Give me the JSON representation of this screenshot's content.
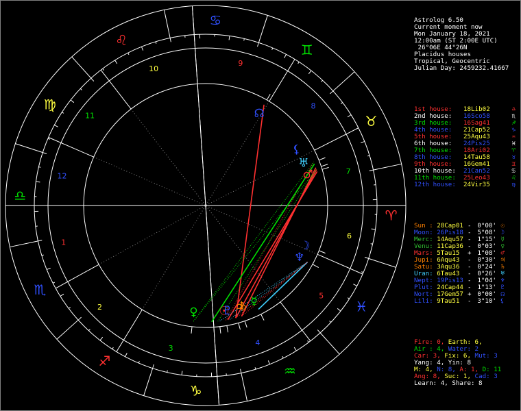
{
  "header": [
    "Astrolog 6.50",
    "Current moment now",
    "Mon January 18, 2021",
    "12:00am (ST 2:00E UTC)",
    " 26°06E 44°26N",
    "Placidus houses",
    "Tropical, Geocentric",
    "Julian Day: 2459232.41667"
  ],
  "colors": {
    "white": "#ffffff",
    "gray": "#c0c0c0",
    "red": "#ff3030",
    "green": "#00e000",
    "yellow": "#ffff40",
    "blue": "#3050ff",
    "cyan": "#40d0ff",
    "magenta": "#ff40ff",
    "orange": "#ff8000",
    "dkgreen": "#30c030"
  },
  "houses": [
    {
      "label": "1st house:",
      "value": "18Lib02",
      "glyph": "♎",
      "color": "red",
      "vcolor": "yellow"
    },
    {
      "label": "2nd house:",
      "value": "16Sco58",
      "glyph": "♏",
      "color": "white",
      "vcolor": "blue"
    },
    {
      "label": "3rd house:",
      "value": "16Sag41",
      "glyph": "♐",
      "color": "green",
      "vcolor": "red"
    },
    {
      "label": "4th house:",
      "value": "21Cap52",
      "glyph": "♑",
      "color": "blue",
      "vcolor": "yellow"
    },
    {
      "label": "5th house:",
      "value": "25Aqu43",
      "glyph": "♒",
      "color": "red",
      "vcolor": "yellow"
    },
    {
      "label": "6th house:",
      "value": "24Pis25",
      "glyph": "♓",
      "color": "white",
      "vcolor": "blue"
    },
    {
      "label": "7th house:",
      "value": "18Ari02",
      "glyph": "♈",
      "color": "green",
      "vcolor": "red"
    },
    {
      "label": "8th house:",
      "value": "14Tau58",
      "glyph": "♉",
      "color": "blue",
      "vcolor": "yellow"
    },
    {
      "label": "9th house:",
      "value": "16Gem41",
      "glyph": "♊",
      "color": "red",
      "vcolor": "yellow"
    },
    {
      "label": "10th house:",
      "value": "21Can52",
      "glyph": "♋",
      "color": "white",
      "vcolor": "blue"
    },
    {
      "label": "11th house:",
      "value": "25Leo43",
      "glyph": "♌",
      "color": "green",
      "vcolor": "red"
    },
    {
      "label": "12th house:",
      "value": "24Vir35",
      "glyph": "♍",
      "color": "blue",
      "vcolor": "yellow"
    }
  ],
  "planets": [
    {
      "name": "Sun :",
      "pos": "28Cap01",
      "sign": "-",
      "speed": "0°00'",
      "glyph": "☉",
      "color": "orange",
      "vcolor": "yellow"
    },
    {
      "name": "Moon:",
      "pos": "26Pis18",
      "sign": "-",
      "speed": "5°08'",
      "glyph": "☽",
      "color": "blue",
      "vcolor": "blue"
    },
    {
      "name": "Merc:",
      "pos": "14Aqu57",
      "sign": "-",
      "speed": "1°15'",
      "glyph": "☿",
      "color": "dkgreen",
      "vcolor": "yellow"
    },
    {
      "name": "Venu:",
      "pos": "11Cap36",
      "sign": "-",
      "speed": "0°03'",
      "glyph": "♀",
      "color": "dkgreen",
      "vcolor": "yellow"
    },
    {
      "name": "Mars:",
      "pos": "5Tau15",
      "sign": "+",
      "speed": "1°08'",
      "glyph": "♂",
      "color": "red",
      "vcolor": "yellow"
    },
    {
      "name": "Jupi:",
      "pos": "6Aqu43",
      "sign": "-",
      "speed": "0°30'",
      "glyph": "♃",
      "color": "orange",
      "vcolor": "yellow"
    },
    {
      "name": "Satu:",
      "pos": "3Aqu36",
      "sign": "-",
      "speed": "0°24'",
      "glyph": "♄",
      "color": "orange",
      "vcolor": "yellow"
    },
    {
      "name": "Uran:",
      "pos": "6Tau43",
      "sign": "-",
      "speed": "0°26'",
      "glyph": "♅",
      "color": "cyan",
      "vcolor": "yellow"
    },
    {
      "name": "Nept:",
      "pos": "19Pis13",
      "sign": "-",
      "speed": "1°04'",
      "glyph": "♆",
      "color": "blue",
      "vcolor": "blue"
    },
    {
      "name": "Plut:",
      "pos": "24Cap44",
      "sign": "-",
      "speed": "1°13'",
      "glyph": "♇",
      "color": "blue",
      "vcolor": "yellow"
    },
    {
      "name": "Nort:",
      "pos": "17Gem57R",
      "sign": "+",
      "speed": "0°00'",
      "glyph": "☊",
      "color": "blue",
      "vcolor": "yellow"
    },
    {
      "name": "Lili:",
      "pos": "9Tau51",
      "sign": "-",
      "speed": "3°10'",
      "glyph": "⚸",
      "color": "blue",
      "vcolor": "yellow"
    }
  ],
  "stats": [
    {
      "parts": [
        {
          "t": "Fire: 0, ",
          "c": "red"
        },
        {
          "t": "Earth: 6,",
          "c": "yellow"
        }
      ]
    },
    {
      "parts": [
        {
          "t": "Air : 4, ",
          "c": "green"
        },
        {
          "t": "Water: 2",
          "c": "blue"
        }
      ]
    },
    {
      "parts": [
        {
          "t": "Car: 3, ",
          "c": "red"
        },
        {
          "t": "Fix: 6, ",
          "c": "yellow"
        },
        {
          "t": "Mut: 3",
          "c": "blue"
        }
      ]
    },
    {
      "parts": [
        {
          "t": "Yang: 4, Yin: 8",
          "c": "white"
        }
      ]
    },
    {
      "parts": [
        {
          "t": "M: 4, ",
          "c": "yellow"
        },
        {
          "t": "N: 8, ",
          "c": "blue"
        },
        {
          "t": "A: 1, ",
          "c": "red"
        },
        {
          "t": "D: 11",
          "c": "green"
        }
      ]
    },
    {
      "parts": [
        {
          "t": "Ang: 8, ",
          "c": "red"
        },
        {
          "t": "Suc: 1, ",
          "c": "yellow"
        },
        {
          "t": "Cad: 3",
          "c": "blue"
        }
      ]
    },
    {
      "parts": [
        {
          "t": "Learn: 4, Share: 8",
          "c": "white"
        }
      ]
    }
  ],
  "wheel": {
    "ascendant_longitude": 198.03,
    "house_cusps": [
      198.03,
      226.97,
      256.68,
      291.87,
      325.72,
      354.42,
      18.03,
      44.97,
      76.68,
      111.87,
      145.72,
      174.58
    ],
    "house_numbers": [
      "1",
      "2",
      "3",
      "4",
      "5",
      "6",
      "7",
      "8",
      "9",
      "10",
      "11",
      "12"
    ],
    "signs": [
      {
        "glyph": "♈",
        "color": "red"
      },
      {
        "glyph": "♉",
        "color": "yellow"
      },
      {
        "glyph": "♊",
        "color": "green"
      },
      {
        "glyph": "♋",
        "color": "blue"
      },
      {
        "glyph": "♌",
        "color": "red"
      },
      {
        "glyph": "♍",
        "color": "yellow"
      },
      {
        "glyph": "♎",
        "color": "green"
      },
      {
        "glyph": "♏",
        "color": "blue"
      },
      {
        "glyph": "♐",
        "color": "red"
      },
      {
        "glyph": "♑",
        "color": "yellow"
      },
      {
        "glyph": "♒",
        "color": "green"
      },
      {
        "glyph": "♓",
        "color": "blue"
      }
    ],
    "bodies": [
      {
        "glyph": "☉",
        "lon": 298.02,
        "color": "red"
      },
      {
        "glyph": "☽",
        "lon": 356.3,
        "color": "blue"
      },
      {
        "glyph": "☿",
        "lon": 314.95,
        "color": "green"
      },
      {
        "glyph": "♀",
        "lon": 281.6,
        "color": "green"
      },
      {
        "glyph": "♂",
        "lon": 35.25,
        "color": "red"
      },
      {
        "glyph": "♃",
        "lon": 306.72,
        "color": "orange"
      },
      {
        "glyph": "♄",
        "lon": 303.6,
        "color": "orange"
      },
      {
        "glyph": "♅",
        "lon": 36.72,
        "color": "cyan"
      },
      {
        "glyph": "♆",
        "lon": 349.22,
        "color": "blue"
      },
      {
        "glyph": "♇",
        "lon": 294.73,
        "color": "blue"
      },
      {
        "glyph": "☊",
        "lon": 77.95,
        "color": "blue"
      },
      {
        "glyph": "⚸",
        "lon": 39.85,
        "color": "blue"
      }
    ],
    "aspects": [
      {
        "a": 299.0,
        "b": 35.0,
        "color": "red",
        "style": "solid"
      },
      {
        "a": 303.0,
        "b": 36.0,
        "color": "red",
        "style": "solid"
      },
      {
        "a": 306.0,
        "b": 37.0,
        "color": "red",
        "style": "solid"
      },
      {
        "a": 298.0,
        "b": 40.0,
        "color": "red",
        "style": "dot"
      },
      {
        "a": 303.0,
        "b": 78.0,
        "color": "red",
        "style": "solid"
      },
      {
        "a": 282.0,
        "b": 40.0,
        "color": "green",
        "style": "dot"
      },
      {
        "a": 282.0,
        "b": 36.0,
        "color": "green",
        "style": "dot"
      },
      {
        "a": 294.0,
        "b": 36.0,
        "color": "green",
        "style": "dot"
      },
      {
        "a": 291.0,
        "b": 39.0,
        "color": "green",
        "style": "solid"
      },
      {
        "a": 300.0,
        "b": 349.0,
        "color": "cyan",
        "style": "dot"
      },
      {
        "a": 295.0,
        "b": 349.0,
        "color": "cyan",
        "style": "dot"
      },
      {
        "a": 315.0,
        "b": 349.0,
        "color": "cyan",
        "style": "solid"
      },
      {
        "a": 306.0,
        "b": 349.0,
        "color": "red",
        "style": "dot"
      },
      {
        "a": 303.0,
        "b": 349.0,
        "color": "red",
        "style": "dot"
      }
    ]
  }
}
